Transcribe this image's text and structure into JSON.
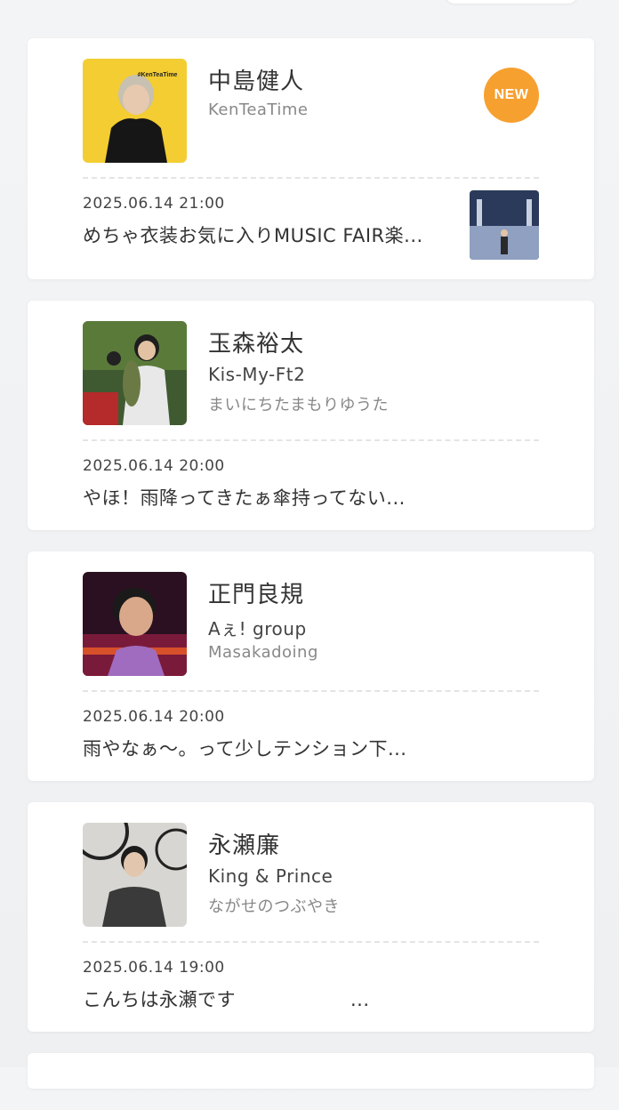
{
  "feed": {
    "posts": [
      {
        "name": "中島健人",
        "blog_title": "KenTeaTime",
        "date": "2025.06.14 21:00",
        "excerpt": "めちゃ衣装お気に入りMUSIC FAIR楽...",
        "badge": "NEW",
        "avatar_text": "#KenTeaTime"
      },
      {
        "name": "玉森裕太",
        "group": "Kis-My-Ft2",
        "blog_title": "まいにちたまもりゆうた",
        "date": "2025.06.14 20:00",
        "excerpt": "やほ！雨降ってきたぁ傘持ってない..."
      },
      {
        "name": "正門良規",
        "group": "Aぇ! group",
        "blog_title": "Masakadoing",
        "date": "2025.06.14 20:00",
        "excerpt": "雨やなぁ〜。って少しテンション下..."
      },
      {
        "name": "永瀬廉",
        "group": "King & Prince",
        "blog_title": "ながせのつぶやき",
        "date": "2025.06.14 19:00",
        "excerpt": "こんちは永瀬です　　　　　　..."
      }
    ]
  },
  "colors": {
    "badge": "#f6a030",
    "card": "#ffffff",
    "background": "#f1f2f4"
  }
}
